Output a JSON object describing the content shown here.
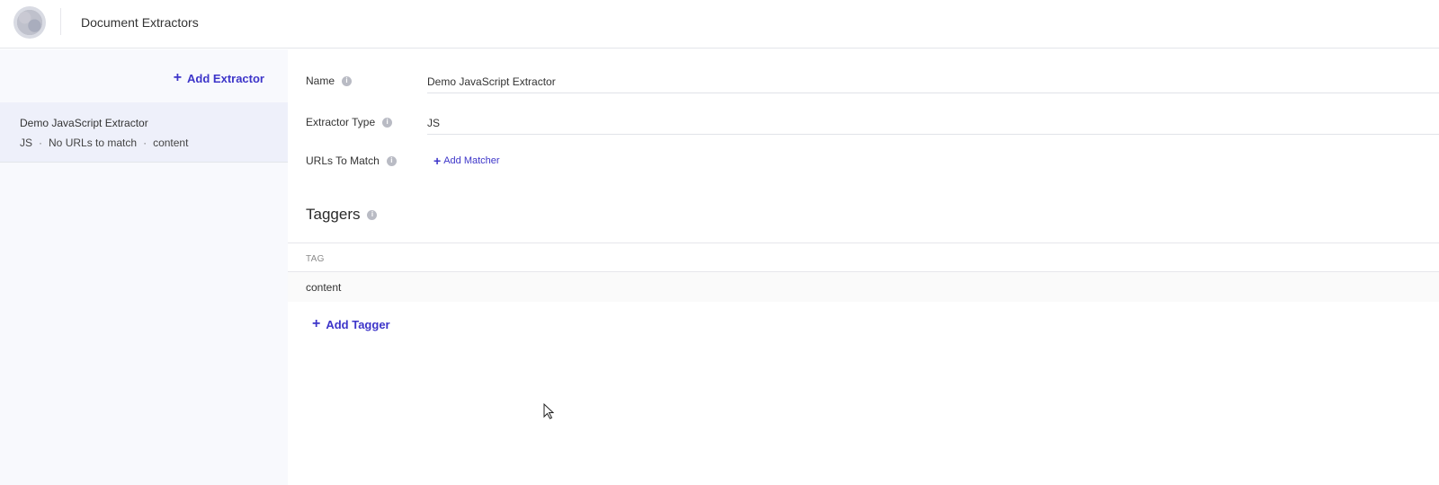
{
  "header": {
    "title": "Document Extractors"
  },
  "sidebar": {
    "add_label": "Add Extractor",
    "items": [
      {
        "name": "Demo JavaScript Extractor",
        "type": "JS",
        "urls": "No URLs to match",
        "tag": "content"
      }
    ]
  },
  "form": {
    "name_label": "Name",
    "name_value": "Demo JavaScript Extractor",
    "type_label": "Extractor Type",
    "type_value": "JS",
    "urls_label": "URLs To Match",
    "add_matcher_label": "Add Matcher"
  },
  "taggers": {
    "title": "Taggers",
    "column_header": "TAG",
    "rows": [
      "content"
    ],
    "add_label": "Add Tagger"
  },
  "colors": {
    "accent": "#3d35c9",
    "sidebar_bg": "#f8f9fd",
    "selected_bg": "#eef0fa"
  },
  "icons": {
    "info": "info-icon",
    "plus": "plus-icon"
  }
}
